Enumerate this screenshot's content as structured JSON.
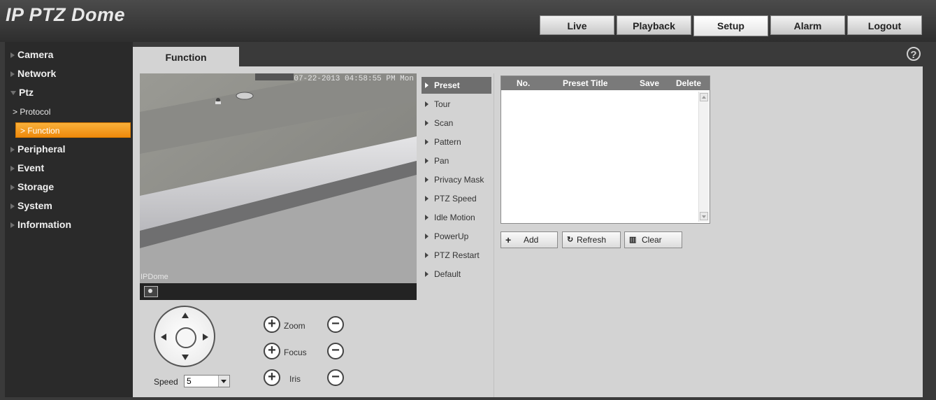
{
  "app": {
    "title": "IP PTZ Dome"
  },
  "nav": {
    "tabs": [
      "Live",
      "Playback",
      "Setup",
      "Alarm",
      "Logout"
    ],
    "active": "Setup"
  },
  "sidebar": {
    "items": [
      "Camera",
      "Network",
      "Ptz",
      "Peripheral",
      "Event",
      "Storage",
      "System",
      "Information"
    ],
    "ptz_sub": [
      "Protocol",
      "Function"
    ],
    "active_sub": "Function"
  },
  "page": {
    "tab": "Function",
    "help_icon": "?"
  },
  "video": {
    "timestamp": "07-22-2013 04:58:55 PM Mon",
    "name": "IPDome"
  },
  "functions": {
    "items": [
      "Preset",
      "Tour",
      "Scan",
      "Pattern",
      "Pan",
      "Privacy Mask",
      "PTZ Speed",
      "Idle Motion",
      "PowerUp",
      "PTZ Restart",
      "Default"
    ],
    "active": "Preset"
  },
  "preset_table": {
    "columns": [
      "No.",
      "Preset Title",
      "Save",
      "Delete"
    ],
    "rows": []
  },
  "buttons": {
    "add": "Add",
    "refresh": "Refresh",
    "clear": "Clear"
  },
  "ptz": {
    "speed_label": "Speed",
    "speed_value": "5",
    "zoom_label": "Zoom",
    "focus_label": "Focus",
    "iris_label": "Iris"
  },
  "colors": {
    "accent": "#f39c1b",
    "header": "#3a3a3a",
    "panel": "#d3d3d3"
  }
}
